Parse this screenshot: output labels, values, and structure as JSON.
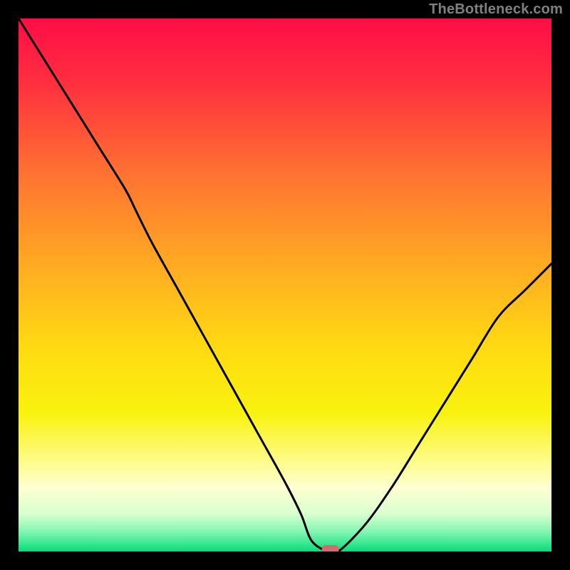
{
  "attribution": "TheBottleneck.com",
  "chart_data": {
    "type": "line",
    "title": "",
    "xlabel": "",
    "ylabel": "",
    "xlim": [
      0,
      100
    ],
    "ylim": [
      0,
      100
    ],
    "x": [
      0,
      5,
      10,
      15,
      20,
      22,
      25,
      30,
      35,
      40,
      45,
      50,
      53,
      55,
      58,
      60,
      65,
      70,
      75,
      80,
      85,
      90,
      95,
      100
    ],
    "values": [
      100,
      92,
      84,
      76,
      68,
      64,
      58,
      49,
      40,
      31,
      22,
      13,
      7,
      2,
      0,
      0,
      5,
      12,
      20,
      28,
      36,
      44,
      49,
      54
    ],
    "series_name": "bottleneck-curve",
    "marker": {
      "x": 58.5,
      "y": 0
    },
    "gradient_stops": [
      {
        "offset": 0.0,
        "color": "#ff0d47"
      },
      {
        "offset": 0.12,
        "color": "#ff2f3f"
      },
      {
        "offset": 0.3,
        "color": "#ff7531"
      },
      {
        "offset": 0.48,
        "color": "#ffb021"
      },
      {
        "offset": 0.62,
        "color": "#ffdb12"
      },
      {
        "offset": 0.74,
        "color": "#f8f20e"
      },
      {
        "offset": 0.82,
        "color": "#fdfb7b"
      },
      {
        "offset": 0.88,
        "color": "#ffffd2"
      },
      {
        "offset": 0.93,
        "color": "#d8ffcf"
      },
      {
        "offset": 0.965,
        "color": "#7cf5b0"
      },
      {
        "offset": 1.0,
        "color": "#07dc7b"
      }
    ]
  }
}
